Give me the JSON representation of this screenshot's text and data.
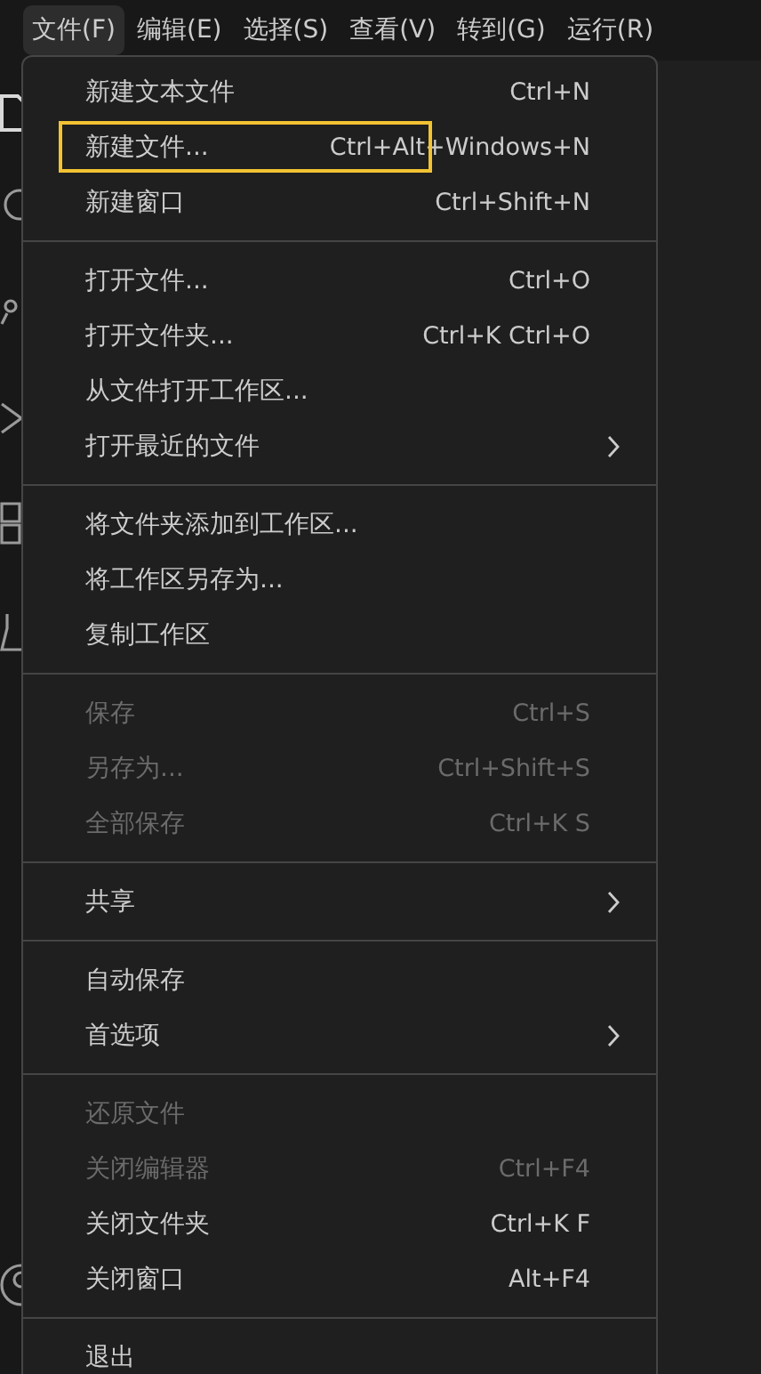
{
  "menu_bar": [
    {
      "label": "文件(F)",
      "selected": true
    },
    {
      "label": "编辑(E)",
      "selected": false
    },
    {
      "label": "选择(S)",
      "selected": false
    },
    {
      "label": "查看(V)",
      "selected": false
    },
    {
      "label": "转到(G)",
      "selected": false
    },
    {
      "label": "运行(R)",
      "selected": false
    }
  ],
  "file_menu": {
    "groups": [
      {
        "items": [
          {
            "label": "新建文本文件",
            "shortcut": "Ctrl+N",
            "disabled": false,
            "submenu": false,
            "outlined": false
          },
          {
            "label": "新建文件...",
            "shortcut": "Ctrl+Alt+Windows+N",
            "disabled": false,
            "submenu": false,
            "outlined": true
          },
          {
            "label": "新建窗口",
            "shortcut": "Ctrl+Shift+N",
            "disabled": false,
            "submenu": false,
            "outlined": false
          }
        ]
      },
      {
        "items": [
          {
            "label": "打开文件...",
            "shortcut": "Ctrl+O",
            "disabled": false,
            "submenu": false,
            "outlined": false
          },
          {
            "label": "打开文件夹...",
            "shortcut": "Ctrl+K Ctrl+O",
            "disabled": false,
            "submenu": false,
            "outlined": false
          },
          {
            "label": "从文件打开工作区...",
            "disabled": false,
            "submenu": false,
            "outlined": false
          },
          {
            "label": "打开最近的文件",
            "disabled": false,
            "submenu": true,
            "outlined": false
          }
        ]
      },
      {
        "items": [
          {
            "label": "将文件夹添加到工作区...",
            "disabled": false,
            "submenu": false,
            "outlined": false
          },
          {
            "label": "将工作区另存为...",
            "disabled": false,
            "submenu": false,
            "outlined": false
          },
          {
            "label": "复制工作区",
            "disabled": false,
            "submenu": false,
            "outlined": false
          }
        ]
      },
      {
        "items": [
          {
            "label": "保存",
            "shortcut": "Ctrl+S",
            "disabled": true,
            "submenu": false,
            "outlined": false
          },
          {
            "label": "另存为...",
            "shortcut": "Ctrl+Shift+S",
            "disabled": true,
            "submenu": false,
            "outlined": false
          },
          {
            "label": "全部保存",
            "shortcut": "Ctrl+K S",
            "disabled": true,
            "submenu": false,
            "outlined": false
          }
        ]
      },
      {
        "items": [
          {
            "label": "共享",
            "disabled": false,
            "submenu": true,
            "outlined": false
          }
        ]
      },
      {
        "items": [
          {
            "label": "自动保存",
            "disabled": false,
            "submenu": false,
            "outlined": false
          },
          {
            "label": "首选项",
            "disabled": false,
            "submenu": true,
            "outlined": false
          }
        ]
      },
      {
        "items": [
          {
            "label": "还原文件",
            "disabled": true,
            "submenu": false,
            "outlined": false
          },
          {
            "label": "关闭编辑器",
            "shortcut": "Ctrl+F4",
            "disabled": true,
            "submenu": false,
            "outlined": false
          },
          {
            "label": "关闭文件夹",
            "shortcut": "Ctrl+K F",
            "disabled": false,
            "submenu": false,
            "outlined": false
          },
          {
            "label": "关闭窗口",
            "shortcut": "Alt+F4",
            "disabled": false,
            "submenu": false,
            "outlined": false
          }
        ]
      },
      {
        "items": [
          {
            "label": "退出",
            "disabled": false,
            "submenu": false,
            "outlined": false
          }
        ]
      }
    ]
  }
}
